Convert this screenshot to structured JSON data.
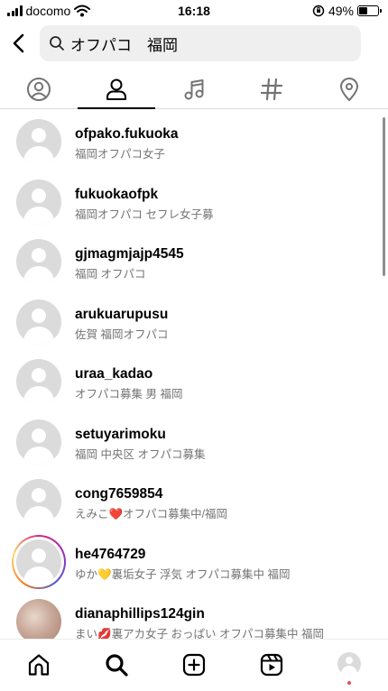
{
  "status_bar": {
    "carrier": "docomo",
    "time": "16:18",
    "battery": "49%",
    "battery_level": 0.49
  },
  "search": {
    "query": "オフパコ　福岡"
  },
  "tabs": [
    {
      "icon": "profile-circle-icon"
    },
    {
      "icon": "person-icon",
      "active": true
    },
    {
      "icon": "music-note-icon"
    },
    {
      "icon": "hashtag-icon"
    },
    {
      "icon": "location-pin-icon"
    }
  ],
  "results": [
    {
      "username": "ofpako.fukuoka",
      "subtitle": "福岡オフパコ女子"
    },
    {
      "username": "fukuokaofpk",
      "subtitle": "福岡オフパコ セフレ女子募"
    },
    {
      "username": "gjmagmjajp4545",
      "subtitle": "福岡 オフパコ"
    },
    {
      "username": "arukuarupusu",
      "subtitle": "佐賀 福岡オフパコ"
    },
    {
      "username": "uraa_kadao",
      "subtitle": "オフパコ募集 男 福岡"
    },
    {
      "username": "setuyarimoku",
      "subtitle": "福岡 中央区 オフパコ募集"
    },
    {
      "username": "cong7659854",
      "subtitle": "えみこ❤️オフパコ募集中/福岡"
    },
    {
      "username": "he4764729",
      "subtitle": "ゆか💛裏垢女子 浮気 オフパコ募集中 福岡"
    },
    {
      "username": "dianaphillips124gin",
      "subtitle": "まい💋裏アカ女子 おっぱい オフパコ募集中 福岡"
    }
  ],
  "bottom_nav": [
    "home-icon",
    "search-icon",
    "create-icon",
    "reels-icon",
    "profile-avatar"
  ]
}
